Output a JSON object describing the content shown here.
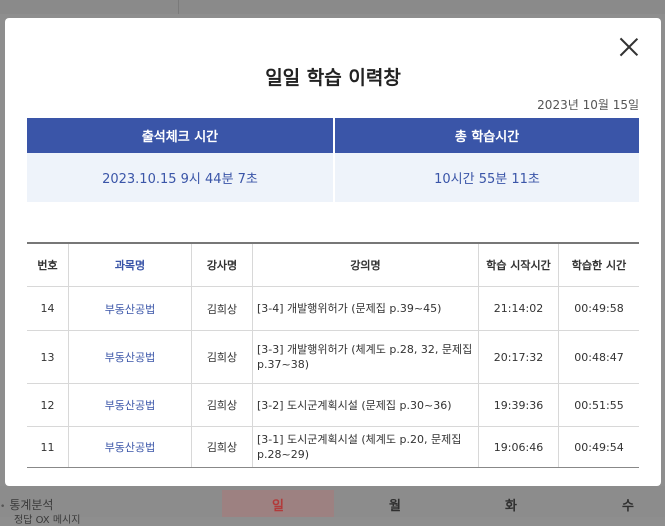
{
  "background": {
    "side_menu": [
      "통계분석",
      "정답 OX 메시지"
    ],
    "weekdays": [
      "일",
      "월",
      "화",
      "수"
    ]
  },
  "modal": {
    "title": "일일 학습 이력창",
    "date": "2023년 10월 15일",
    "summary": {
      "headers": [
        "출석체크 시간",
        "총 학습시간"
      ],
      "values": [
        "2023.10.15 9시 44분 7초",
        "10시간 55분 11초"
      ]
    },
    "table": {
      "headers": [
        "번호",
        "과목명",
        "강사명",
        "강의명",
        "학습 시작시간",
        "학습한 시간"
      ],
      "rows": [
        {
          "no": "14",
          "subject": "부동산공법",
          "teacher": "김희상",
          "lecture": "[3-4] 개발행위허가 (문제집 p.39~45)",
          "start": "21:14:02",
          "duration": "00:49:58"
        },
        {
          "no": "13",
          "subject": "부동산공법",
          "teacher": "김희상",
          "lecture": "[3-3] 개발행위허가 (체계도 p.28, 32, 문제집 p.37~38)",
          "start": "20:17:32",
          "duration": "00:48:47"
        },
        {
          "no": "12",
          "subject": "부동산공법",
          "teacher": "김희상",
          "lecture": "[3-2] 도시군계획시설 (문제집 p.30~36)",
          "start": "19:39:36",
          "duration": "00:51:55"
        },
        {
          "no": "11",
          "subject": "부동산공법",
          "teacher": "김희상",
          "lecture": "[3-1] 도시군계획시설 (체계도 p.20, 문제집 p.28~29)",
          "start": "19:06:46",
          "duration": "00:49:54"
        }
      ]
    }
  }
}
